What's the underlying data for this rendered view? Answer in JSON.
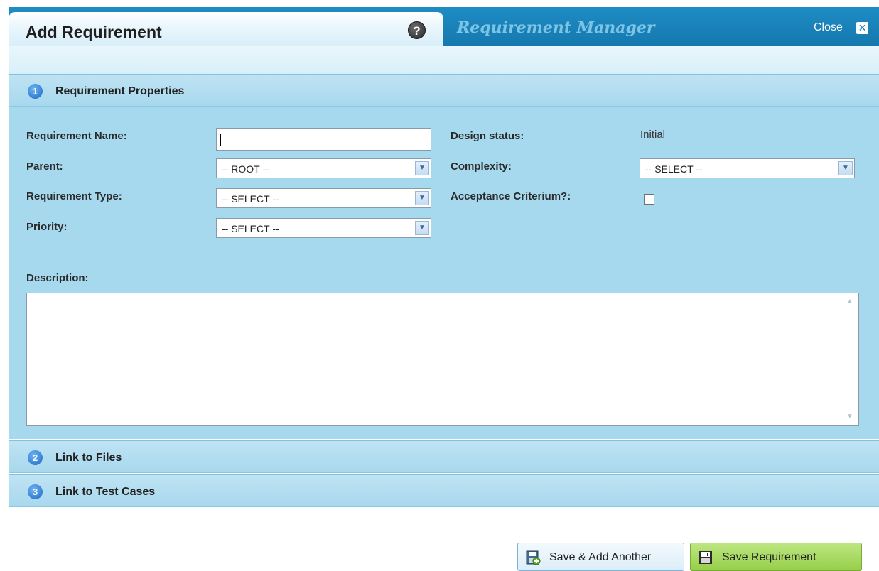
{
  "header": {
    "title": "Add Requirement",
    "help_icon": "?",
    "inactive_tab": "Requirement Manager",
    "close_label": "Close"
  },
  "sections": [
    {
      "number": "1",
      "label": "Requirement Properties"
    },
    {
      "number": "2",
      "label": "Link to Files"
    },
    {
      "number": "3",
      "label": "Link to Test Cases"
    }
  ],
  "form": {
    "requirement_name": {
      "label": "Requirement Name:",
      "value": ""
    },
    "parent": {
      "label": "Parent:",
      "value": "-- ROOT --"
    },
    "requirement_type": {
      "label": "Requirement Type:",
      "value": "-- SELECT --"
    },
    "priority": {
      "label": "Priority:",
      "value": "-- SELECT --"
    },
    "design_status": {
      "label": "Design status:",
      "value": "Initial"
    },
    "complexity": {
      "label": "Complexity:",
      "value": "-- SELECT --"
    },
    "acceptance_criterium": {
      "label": "Acceptance Criterium?:",
      "checked": false
    },
    "description": {
      "label": "Description:",
      "value": ""
    }
  },
  "buttons": {
    "save_add_another": "Save & Add Another",
    "save_requirement": "Save Requirement"
  },
  "icons": {
    "help": "help-icon",
    "close": "close-icon",
    "dropdown": "chevron-down-icon",
    "save_add": "save-add-icon",
    "save": "floppy-disk-icon"
  },
  "colors": {
    "header": "#1b82ba",
    "panel": "#a6d8ee",
    "section_bar": "#b3ddf1",
    "save_button": "#a8d964"
  }
}
